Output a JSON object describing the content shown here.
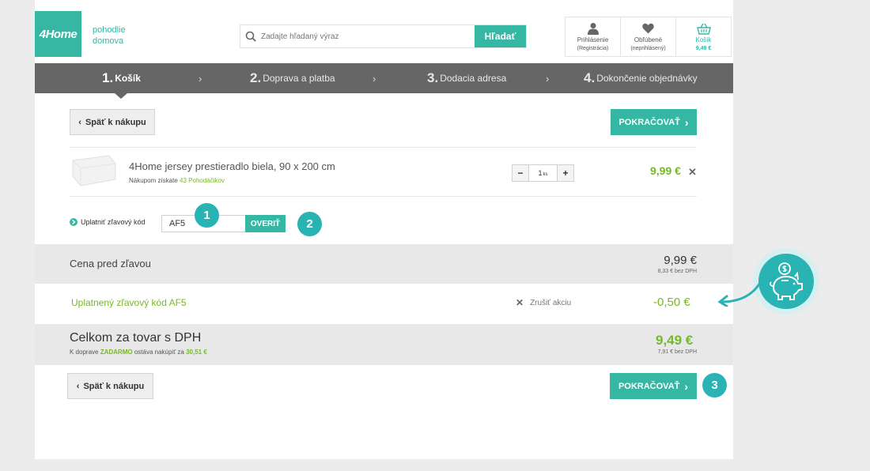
{
  "header": {
    "logo": "4Home",
    "tagline_line1": "pohodlie",
    "tagline_line2": "domova",
    "search_placeholder": "Zadajte hľadaný výraz",
    "search_button": "Hľadať",
    "account": [
      {
        "label": "Prihlásenie",
        "sub": "(Registrácia)",
        "icon": "user-icon"
      },
      {
        "label": "Obľúbené",
        "sub": "(neprihlásený)",
        "icon": "heart-icon"
      },
      {
        "label": "Košík",
        "sub": "9,49 €",
        "icon": "basket-icon"
      }
    ]
  },
  "steps": [
    {
      "num": "1.",
      "label": "Košík",
      "active": true
    },
    {
      "num": "2.",
      "label": "Doprava a platba",
      "active": false
    },
    {
      "num": "3.",
      "label": "Dodacia adresa",
      "active": false
    },
    {
      "num": "4.",
      "label": "Dokončenie objednávky",
      "active": false
    }
  ],
  "buttons": {
    "back": "Späť k nákupu",
    "continue": "POKRAČOVAŤ"
  },
  "product": {
    "name": "4Home jersey prestieradlo biela, 90 x 200 cm",
    "points_prefix": "Nákupom získate",
    "points": "43 Pohodáčikov",
    "qty": "1",
    "qty_unit": "ks",
    "price": "9,99 €"
  },
  "coupon": {
    "label": "Uplatniť zľavový kód",
    "value": "AF5",
    "verify": "OVERIŤ"
  },
  "summary": {
    "before_label": "Cena pred zľavou",
    "before_value": "9,99 €",
    "before_net": "8,33 € bez DPH",
    "discount_label": "Uplatnený zľavový kód AF5",
    "cancel_label": "Zrušiť akciu",
    "discount_value": "-0,50 €",
    "total_label": "Celkom za tovar s DPH",
    "ship_prefix": "K doprave",
    "ship_free": "ZADARMO",
    "ship_mid": "ostáva nakúpiť za",
    "ship_amount": "30,51 €",
    "total_value": "9,49 €",
    "total_net": "7,91 € bez DPH"
  },
  "badges": [
    "1",
    "2",
    "3"
  ],
  "colors": {
    "accent": "#35b7a4",
    "green": "#77b82a",
    "badge": "#2ab3b3",
    "steps_bar": "#666666"
  }
}
